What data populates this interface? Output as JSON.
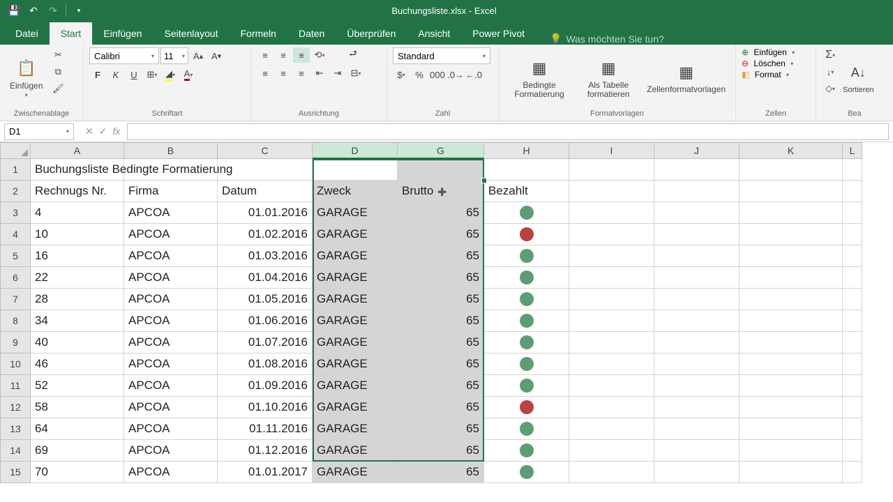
{
  "title": "Buchungsliste.xlsx - Excel",
  "tabs": [
    "Datei",
    "Start",
    "Einfügen",
    "Seitenlayout",
    "Formeln",
    "Daten",
    "Überprüfen",
    "Ansicht",
    "Power Pivot"
  ],
  "tell_me": "Was möchten Sie tun?",
  "ribbon": {
    "paste": "Einfügen",
    "clipboard_label": "Zwischenablage",
    "font_name": "Calibri",
    "font_size": "11",
    "font_label": "Schriftart",
    "align_label": "Ausrichtung",
    "number_format": "Standard",
    "number_label": "Zahl",
    "cond_format": "Bedingte Formatierung",
    "table_format": "Als Tabelle formatieren",
    "cell_styles": "Zellenformatvorlagen",
    "styles_label": "Formatvorlagen",
    "insert": "Einfügen",
    "delete": "Löschen",
    "format": "Format",
    "cells_label": "Zellen",
    "sort": "Sortieren u. Filtern",
    "editing_label": "Bea",
    "sort_short": "Sortieren"
  },
  "name_box": "D1",
  "columns": [
    "A",
    "B",
    "C",
    "D",
    "G",
    "H",
    "I",
    "J",
    "K",
    "L"
  ],
  "selected_cols": [
    "D",
    "G"
  ],
  "headers": {
    "title_cell": "Buchungsliste Bedingte Formatierung",
    "a": "Rechnugs Nr.",
    "b": "Firma",
    "c": "Datum",
    "d": "Zweck",
    "g": "Brutto",
    "h": "Bezahlt"
  },
  "rows": [
    {
      "nr": "4",
      "firma": "APCOA",
      "datum": "01.01.2016",
      "zweck": "GARAGE",
      "brutto": "65",
      "bezahlt": "green"
    },
    {
      "nr": "10",
      "firma": "APCOA",
      "datum": "01.02.2016",
      "zweck": "GARAGE",
      "brutto": "65",
      "bezahlt": "red"
    },
    {
      "nr": "16",
      "firma": "APCOA",
      "datum": "01.03.2016",
      "zweck": "GARAGE",
      "brutto": "65",
      "bezahlt": "green"
    },
    {
      "nr": "22",
      "firma": "APCOA",
      "datum": "01.04.2016",
      "zweck": "GARAGE",
      "brutto": "65",
      "bezahlt": "green"
    },
    {
      "nr": "28",
      "firma": "APCOA",
      "datum": "01.05.2016",
      "zweck": "GARAGE",
      "brutto": "65",
      "bezahlt": "green"
    },
    {
      "nr": "34",
      "firma": "APCOA",
      "datum": "01.06.2016",
      "zweck": "GARAGE",
      "brutto": "65",
      "bezahlt": "green"
    },
    {
      "nr": "40",
      "firma": "APCOA",
      "datum": "01.07.2016",
      "zweck": "GARAGE",
      "brutto": "65",
      "bezahlt": "green"
    },
    {
      "nr": "46",
      "firma": "APCOA",
      "datum": "01.08.2016",
      "zweck": "GARAGE",
      "brutto": "65",
      "bezahlt": "green"
    },
    {
      "nr": "52",
      "firma": "APCOA",
      "datum": "01.09.2016",
      "zweck": "GARAGE",
      "brutto": "65",
      "bezahlt": "green"
    },
    {
      "nr": "58",
      "firma": "APCOA",
      "datum": "01.10.2016",
      "zweck": "GARAGE",
      "brutto": "65",
      "bezahlt": "red"
    },
    {
      "nr": "64",
      "firma": "APCOA",
      "datum": "01.11.2016",
      "zweck": "GARAGE",
      "brutto": "65",
      "bezahlt": "green"
    },
    {
      "nr": "69",
      "firma": "APCOA",
      "datum": "01.12.2016",
      "zweck": "GARAGE",
      "brutto": "65",
      "bezahlt": "green"
    },
    {
      "nr": "70",
      "firma": "APCOA",
      "datum": "01.01.2017",
      "zweck": "GARAGE",
      "brutto": "65",
      "bezahlt": "green"
    }
  ]
}
